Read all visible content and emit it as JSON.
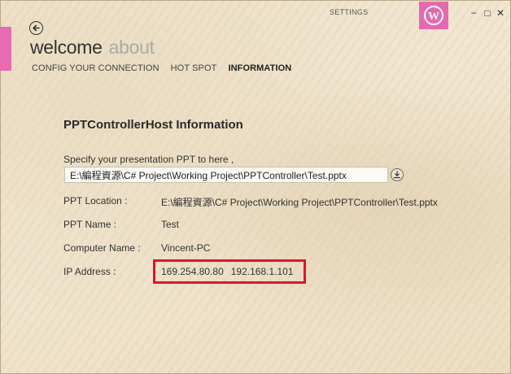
{
  "window": {
    "settings_label": "SETTINGS",
    "accent_color": "#e86ab2",
    "minimize_symbol": "−",
    "maximize_symbol": "□",
    "close_symbol": "✕"
  },
  "header": {
    "title_active": "welcome",
    "title_inactive": "about"
  },
  "tabs": [
    {
      "label": "CONFIG YOUR CONNECTION",
      "selected": false
    },
    {
      "label": "HOT SPOT",
      "selected": false
    },
    {
      "label": "INFORMATION",
      "selected": true
    }
  ],
  "main": {
    "section_title": "PPTControllerHost Information",
    "specify_label": "Specify your presentation PPT to here ,",
    "ppt_path_input_value": "E:\\編程資源\\C# Project\\Working Project\\PPTController\\Test.pptx",
    "rows": [
      {
        "label": "PPT Location :",
        "value": "E:\\編程資源\\C# Project\\Working Project\\PPTController\\Test.pptx"
      },
      {
        "label": "PPT Name :",
        "value": "Test"
      },
      {
        "label": "Computer Name :",
        "value": "Vincent-PC"
      },
      {
        "label": "IP Address :",
        "value": ""
      }
    ],
    "ip_addresses": [
      "169.254.80.80",
      "192.168.1.101"
    ],
    "highlight_color": "#e0152a"
  },
  "icons": {
    "back": "back-arrow-icon",
    "wordpress": "wordpress-icon",
    "browse": "download-icon"
  }
}
